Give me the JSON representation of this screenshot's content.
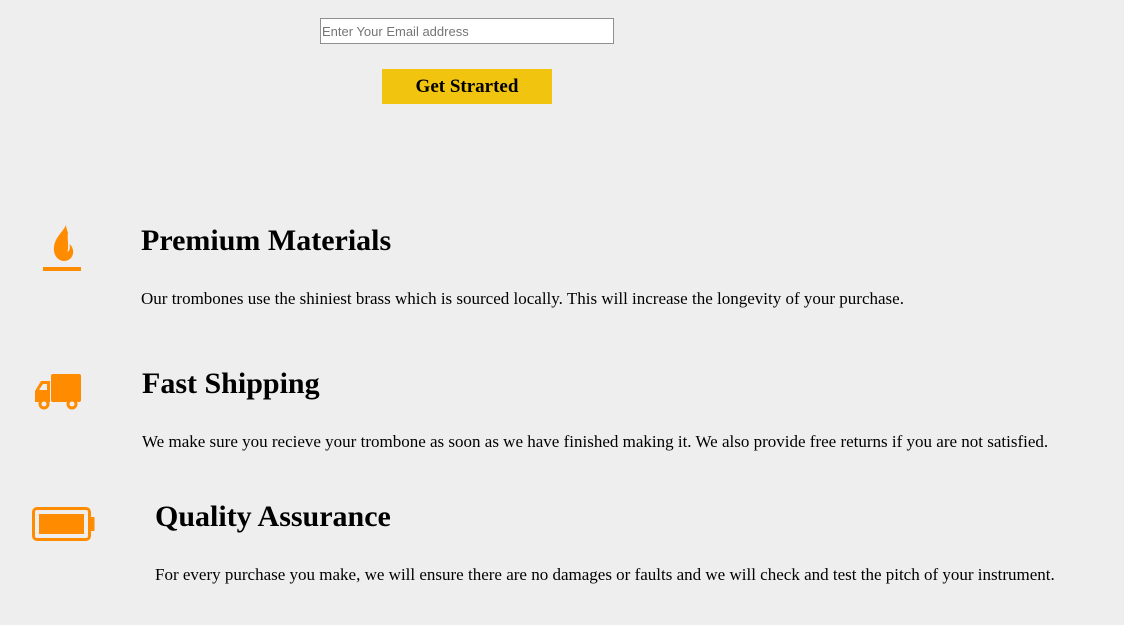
{
  "signup": {
    "email_placeholder": "Enter Your Email address",
    "email_value": "",
    "submit_label": "Get Strarted"
  },
  "colors": {
    "background": "#eeeeee",
    "button": "#f1c40f",
    "icon_accent": "#ff8c00"
  },
  "features": [
    {
      "icon": "fire-icon",
      "title": "Premium Materials",
      "description": "Our trombones use the shiniest brass which is sourced locally. This will increase the longevity of your purchase."
    },
    {
      "icon": "truck-icon",
      "title": "Fast Shipping",
      "description": "We make sure you recieve your trombone as soon as we have finished making it. We also provide free returns if you are not satisfied."
    },
    {
      "icon": "battery-full-icon",
      "title": "Quality Assurance",
      "description": "For every purchase you make, we will ensure there are no damages or faults and we will check and test the pitch of your instrument."
    }
  ]
}
